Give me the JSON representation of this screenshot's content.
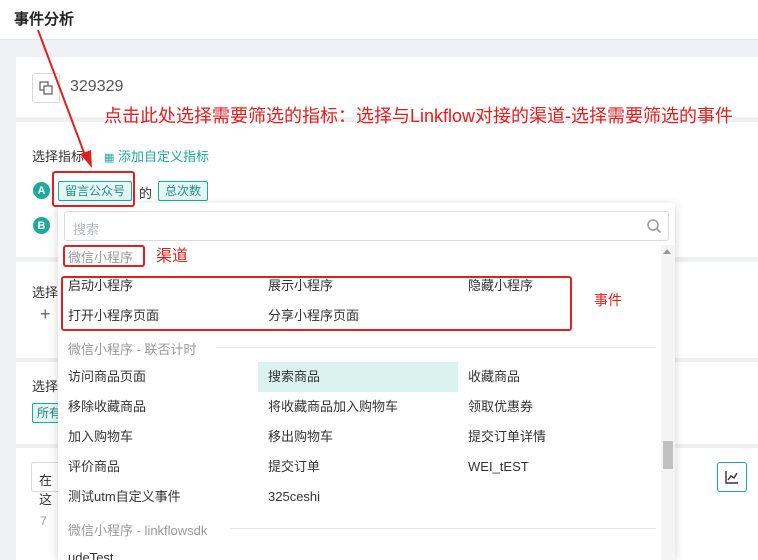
{
  "page": {
    "title": "事件分析"
  },
  "event": {
    "id": "329329"
  },
  "metrics": {
    "label": "选择指标",
    "add_custom": "添加自定义指标",
    "row_a": {
      "letter": "A",
      "event_tag": "留言公众号",
      "connector": "的",
      "metric_tag": "总次数"
    },
    "row_b": {
      "letter": "B"
    }
  },
  "background_fragments": {
    "section2_label": "选择",
    "plus": "+",
    "section3_label": "选择",
    "all_tag": "所有",
    "select_prefix": "在这",
    "seven": "7"
  },
  "annotations": {
    "main": "点击此处选择需要筛选的指标：选择与Linkflow对接的渠道-选择需要筛选的事件",
    "channel": "渠道",
    "event": "事件"
  },
  "dropdown": {
    "search_placeholder": "搜索",
    "groups": [
      {
        "title": "微信小程序",
        "items": [
          "启动小程序",
          "展示小程序",
          "隐藏小程序",
          "打开小程序页面",
          "分享小程序页面"
        ]
      },
      {
        "title": "微信小程序 - 联否计时",
        "items": [
          "访问商品页面",
          "搜索商品",
          "收藏商品",
          "移除收藏商品",
          "将收藏商品加入购物车",
          "领取优惠券",
          "加入购物车",
          "移出购物车",
          "提交订单详情",
          "评价商品",
          "提交订单",
          "WEI_tEST",
          "测试utm自定义事件",
          "325ceshi"
        ]
      },
      {
        "title": "微信小程序 - linkflowsdk",
        "items": [
          "udeTest"
        ]
      }
    ],
    "active_item": "搜索商品"
  },
  "colors": {
    "accent": "#1fa99b",
    "annotation": "#e02020"
  }
}
